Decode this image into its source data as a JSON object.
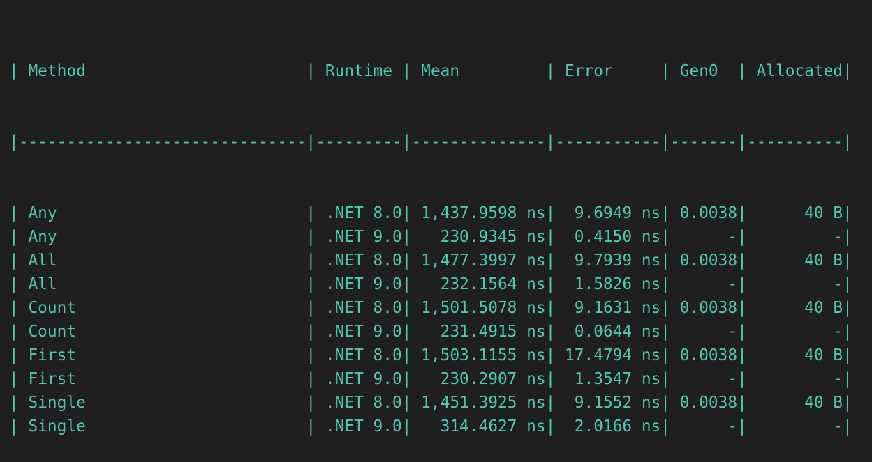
{
  "table": {
    "headers": {
      "method": " Method",
      "runtime": " Runtime ",
      "mean": " Mean",
      "error": " Error",
      "gen0": " Gen0",
      "allocated": " Allocated"
    },
    "separator": {
      "method": "------------------------------",
      "runtime": "---------",
      "mean": "--------------",
      "error": "-----------",
      "gen0": "-------",
      "allocated": "----------"
    },
    "rows": [
      {
        "method": " Any",
        "runtime": " .NET 8.0",
        "mean": "1,437.9598 ns",
        "error": "9.6949 ns",
        "gen0": "0.0038",
        "allocated": "40 B"
      },
      {
        "method": " Any",
        "runtime": " .NET 9.0",
        "mean": "230.9345 ns",
        "error": "0.4150 ns",
        "gen0": "-",
        "allocated": "-"
      },
      {
        "method": " All",
        "runtime": " .NET 8.0",
        "mean": "1,477.3997 ns",
        "error": "9.7939 ns",
        "gen0": "0.0038",
        "allocated": "40 B"
      },
      {
        "method": " All",
        "runtime": " .NET 9.0",
        "mean": "232.1564 ns",
        "error": "1.5826 ns",
        "gen0": "-",
        "allocated": "-"
      },
      {
        "method": " Count",
        "runtime": " .NET 8.0",
        "mean": "1,501.5078 ns",
        "error": "9.1631 ns",
        "gen0": "0.0038",
        "allocated": "40 B"
      },
      {
        "method": " Count",
        "runtime": " .NET 9.0",
        "mean": "231.4915 ns",
        "error": "0.0644 ns",
        "gen0": "-",
        "allocated": "-"
      },
      {
        "method": " First",
        "runtime": " .NET 8.0",
        "mean": "1,503.1155 ns",
        "error": "17.4794 ns",
        "gen0": "0.0038",
        "allocated": "40 B"
      },
      {
        "method": " First",
        "runtime": " .NET 9.0",
        "mean": "230.2907 ns",
        "error": "1.3547 ns",
        "gen0": "-",
        "allocated": "-"
      },
      {
        "method": " Single",
        "runtime": " .NET 8.0",
        "mean": "1,451.3925 ns",
        "error": "9.1552 ns",
        "gen0": "0.0038",
        "allocated": "40 B"
      },
      {
        "method": " Single",
        "runtime": " .NET 9.0",
        "mean": "314.4627 ns",
        "error": "2.0166 ns",
        "gen0": "-",
        "allocated": "-"
      }
    ]
  }
}
